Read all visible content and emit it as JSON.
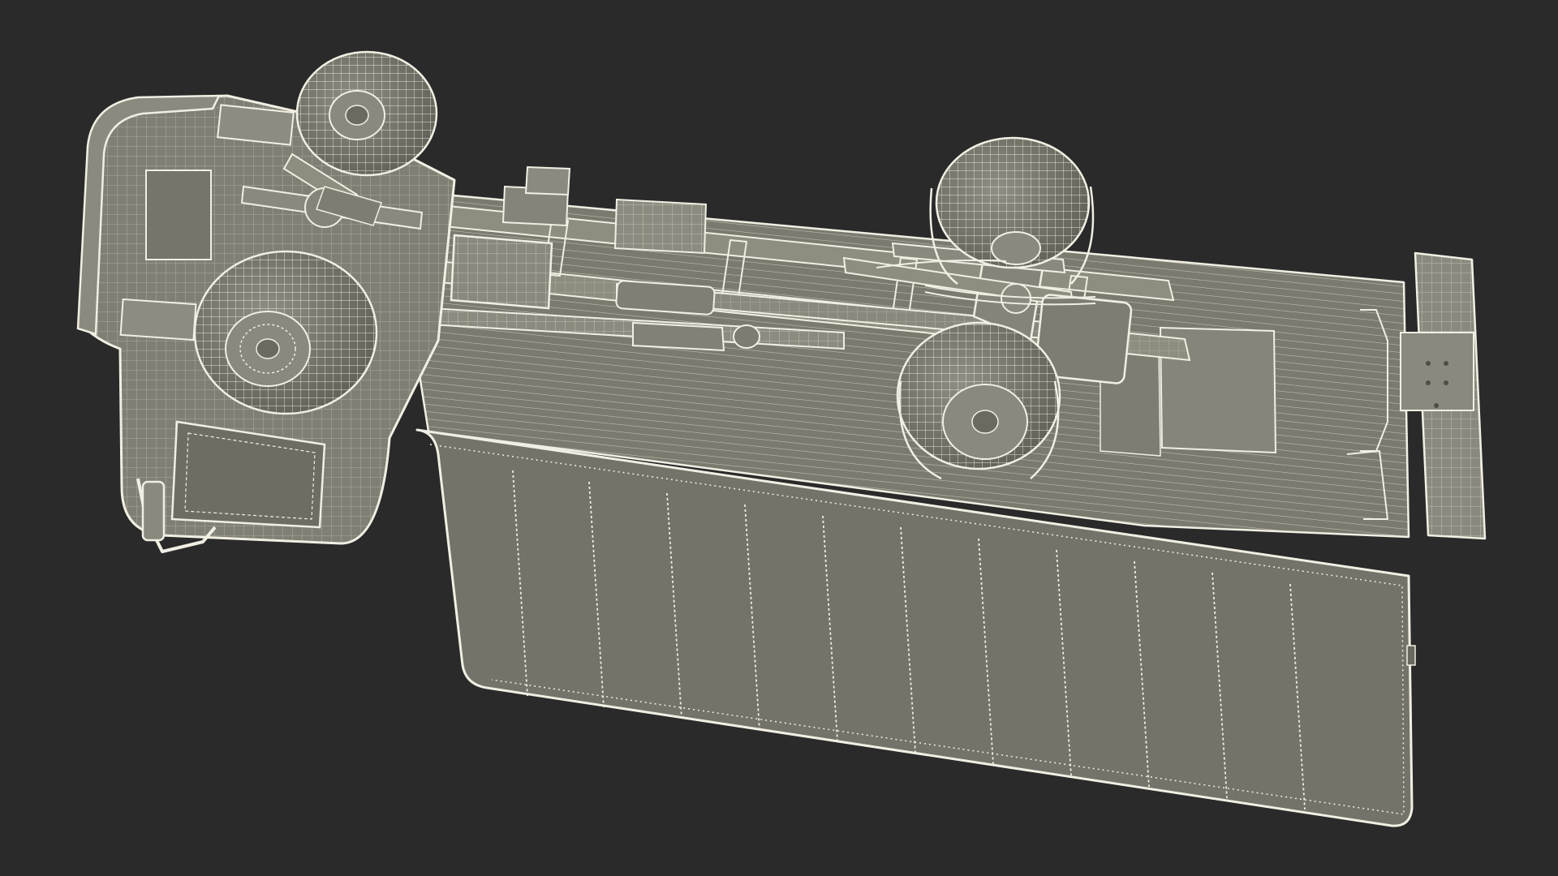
{
  "scene": {
    "subject": "box truck",
    "render_style": "wireframe",
    "view": "underside",
    "caption": ""
  },
  "colors": {
    "background": "#2a2a2a",
    "surface": "#7a7a6e",
    "surface_light": "#8d8c80",
    "surface_dark": "#5e5d54",
    "wire": "#f1efe3",
    "shadow": "#4a4a43"
  },
  "counts": {
    "cargo_panels": 11,
    "wheels_visible": 4
  }
}
